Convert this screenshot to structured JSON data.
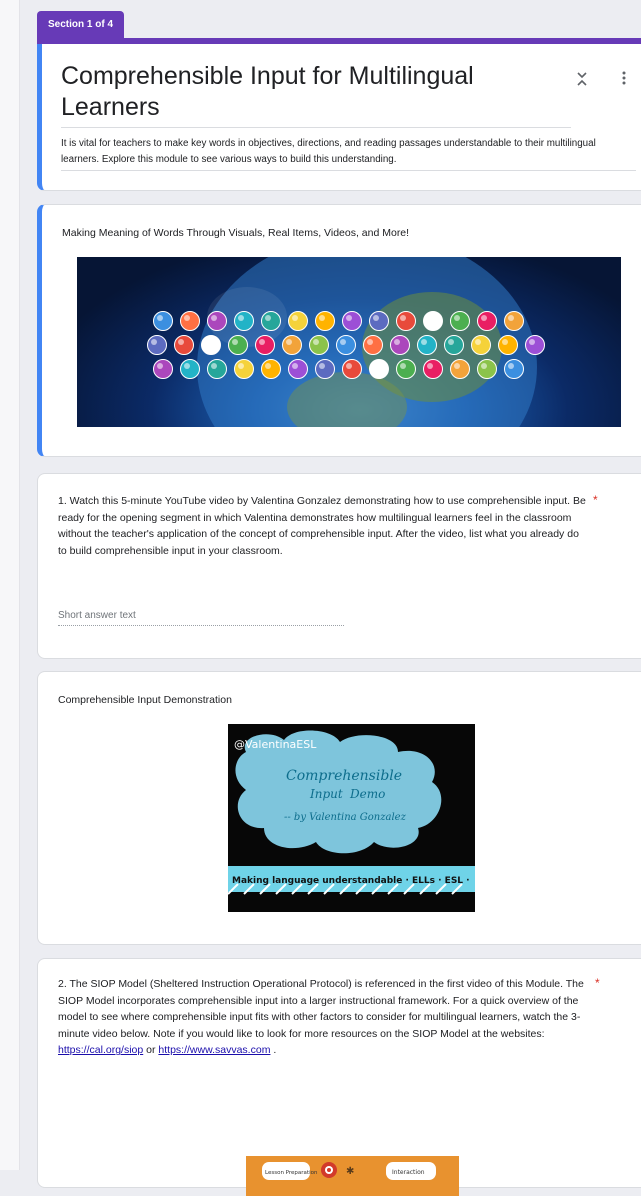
{
  "section": {
    "label": "Section 1 of 4"
  },
  "header": {
    "title": "Comprehensible Input for Multilingual Learners",
    "description": "It is vital for teachers to make key words in objectives, directions, and reading passages understandable to their multilingual learners.  Explore this module to see various ways to build this understanding."
  },
  "image_block_1": {
    "title": "Making Meaning of Words Through Visuals, Real Items, Videos, and More!"
  },
  "question_1": {
    "text": "1. Watch this 5-minute YouTube video by Valentina Gonzalez demonstrating how to use comprehensible input.  Be ready for the opening segment in which Valentina demonstrates how multilingual learners feel in the classroom without the teacher's application of the concept of comprehensible input.  After the video, list what you already do to build comprehensible input in your classroom.",
    "required_mark": "*",
    "placeholder": "Short answer text"
  },
  "image_block_2": {
    "title": "Comprehensible Input Demonstration",
    "image_text": {
      "handle": "@ValentinaESL",
      "line1": "Comprehensible",
      "line2": "Input",
      "line2b": "Demo",
      "line3": "-- by Valentina Gonzalez",
      "banner": "Making language understandable · ELLs · ESL ·"
    }
  },
  "question_2": {
    "text_start": "2. The SIOP Model (Sheltered Instruction Operational Protocol) is referenced in the first video of this Module.  The SIOP Model incorporates comprehensible input into a larger instructional framework.  For a quick overview of the model to see where comprehensible input fits with other factors to consider for multilingual learners, watch the 3-minute video below.  Note if you would like to look for more resources on the SIOP Model at the websites:",
    "link1": "https://cal.org/siop",
    "or": "or",
    "link2": "https://www.savvas.com",
    "text_end": ".",
    "required_mark": "*",
    "image_text": {
      "label1": "Lesson Preparation",
      "label2": "Interaction"
    }
  },
  "icons": {
    "collapse": "collapse-icon",
    "more": "more-vert-icon"
  },
  "colors": {
    "accent": "#673ab7",
    "card_border": "#4285f4",
    "required": "#d93025",
    "link": "#1a0dab"
  }
}
